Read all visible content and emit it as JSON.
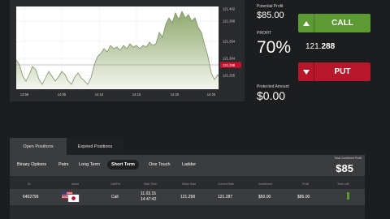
{
  "chart": {
    "y_ticks": [
      "121.402",
      "121.368",
      "121.354",
      "121.304",
      "121.288",
      "121.255"
    ],
    "x_ticks": [
      "13:58",
      "14:05",
      "14:10",
      "14:15",
      "14:20",
      "14:25"
    ],
    "current_price_tag": "121.288",
    "colors": {
      "line": "#7a8f62",
      "fill_top": "#8fa86e",
      "fill_bottom": "#f4f6ef",
      "bg": "#ffffff",
      "current_tag": "#c8102e"
    }
  },
  "trade": {
    "potential_profit_label": "Potential Profit",
    "potential_profit_value": "$85.00",
    "profit_label": "PROFIT",
    "profit_value": "70%",
    "price_main": "121.",
    "price_bold": "288",
    "protected_label": "Protected Amount",
    "protected_value": "$0.00",
    "call_label": "CALL",
    "put_label": "PUT",
    "call_icon": "chevron-up-icon",
    "put_icon": "chevron-down-icon",
    "colors": {
      "call": "#5c9a34",
      "put": "#b8162a"
    }
  },
  "positions": {
    "tabs": [
      {
        "label": "Open Positions",
        "active": true
      },
      {
        "label": "Expired Positions",
        "active": false
      }
    ],
    "filters": [
      {
        "label": "Binary Options",
        "active": false
      },
      {
        "label": "Pairs",
        "active": false
      },
      {
        "label": "Long Term",
        "active": false
      },
      {
        "label": "Short Term",
        "active": true
      },
      {
        "label": "One Touch",
        "active": false
      },
      {
        "label": "Ladder",
        "active": false
      }
    ],
    "total_label": "Total Combined Profit",
    "total_value": "$85",
    "columns": [
      "ID",
      "Asset",
      "Call/Put",
      "Start Time",
      "Strike Rate",
      "Current Rate",
      "Investment",
      "Profit",
      "Time Left"
    ],
    "rows": [
      {
        "id": "6402799",
        "asset_icon": "currency-pair-flag-icon",
        "direction": "Call",
        "start_time_1": "11.03.15",
        "start_time_2": "14:47:42",
        "strike_rate": "121.258",
        "current_rate": "121.287",
        "investment": "$50.00",
        "profit": "$85.00"
      }
    ]
  }
}
